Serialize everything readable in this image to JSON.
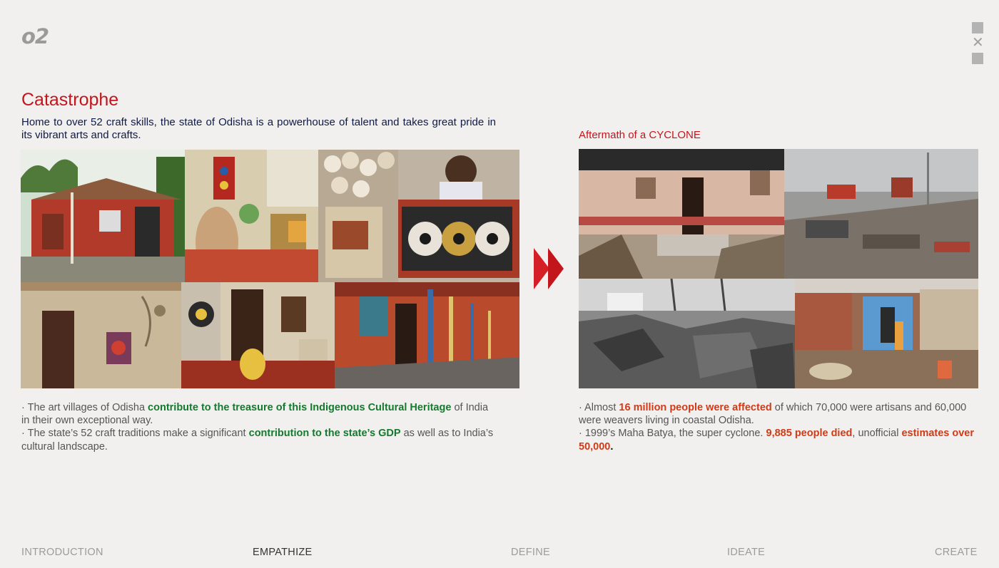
{
  "page_number": "o2",
  "title": "Catastrophe",
  "intro": "Home to over 52 craft skills, the state of Odisha is a powerhouse of talent and takes great pride in its vibrant arts and crafts.",
  "right_heading": "Aftermath of a CYCLONE",
  "left_text": {
    "p1_a": "· The art villages of Odisha ",
    "p1_hl": "contribute to the treasure of this Indigenous Cultural Heritage",
    "p1_b": " of India in their own exceptional way.",
    "p2_a": "· The state’s 52 craft traditions make a significant ",
    "p2_hl": "contribution to the state’s GDP",
    "p2_b": " as well as to India’s cultural landscape."
  },
  "right_text": {
    "p1_a": "·  Almost ",
    "p1_hl": "16 million people were affected",
    "p1_b": " of which 70,000 were artisans and 60,000 were weavers living in coastal Odisha.",
    "p2_a": "· 1999’s Maha Batya, the super cyclone. ",
    "p2_hl1": "9,885 people died",
    "p2_b": ", unofficial ",
    "p2_hl2": "estimates over 50,000",
    "p2_c": "."
  },
  "nav": [
    "INTRODUCTION",
    "EMPATHIZE",
    "DEFINE",
    "IDEATE",
    "CREATE"
  ],
  "colors": {
    "accent_red": "#c3161c",
    "highlight_green": "#147a2e",
    "highlight_red": "#d23a15",
    "heading_navy": "#0f1a44"
  },
  "icons": [
    "minimize-square-icon",
    "close-icon",
    "square-icon",
    "double-chevron-right-icon"
  ]
}
